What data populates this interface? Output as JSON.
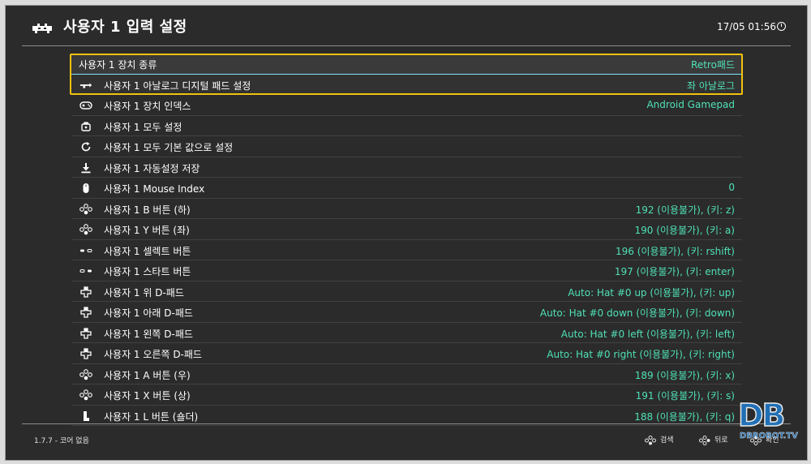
{
  "header": {
    "title": "사용자 1 입력 설정",
    "clock": "17/05 01:56"
  },
  "rows": [
    {
      "icon": "none",
      "label": "사용자 1 장치 종류",
      "value": "Retro패드"
    },
    {
      "icon": "analog-dpad-icon",
      "label": "사용자 1 아날로그 디지털 패드 설정",
      "value": "좌 아날로그"
    },
    {
      "icon": "gamepad-icon",
      "label": "사용자 1 장치 인덱스",
      "value": "Android Gamepad"
    },
    {
      "icon": "bind-all-icon",
      "label": "사용자 1 모두 설정",
      "value": ""
    },
    {
      "icon": "reload-icon",
      "label": "사용자 1 모두 기본 값으로 설정",
      "value": ""
    },
    {
      "icon": "download-icon",
      "label": "사용자 1 자동설정 저장",
      "value": ""
    },
    {
      "icon": "mouse-icon",
      "label": "사용자 1 Mouse Index",
      "value": "0"
    },
    {
      "icon": "face-buttons-icon",
      "label": "사용자 1 B 버튼 (하)",
      "value": "192 (이용불가), (키: z)"
    },
    {
      "icon": "face-buttons-icon",
      "label": "사용자 1 Y 버튼 (좌)",
      "value": "190 (이용불가), (키: a)"
    },
    {
      "icon": "select-icon",
      "label": "사용자 1 셀렉트 버튼",
      "value": "196 (이용불가), (키: rshift)"
    },
    {
      "icon": "start-icon",
      "label": "사용자 1 스타트 버튼",
      "value": "197 (이용불가), (키: enter)"
    },
    {
      "icon": "dpad-icon",
      "label": "사용자 1 위 D-패드",
      "value": "Auto: Hat #0 up (이용불가), (키: up)"
    },
    {
      "icon": "dpad-icon",
      "label": "사용자 1 아래 D-패드",
      "value": "Auto: Hat #0 down (이용불가), (키: down)"
    },
    {
      "icon": "dpad-icon",
      "label": "사용자 1 왼쪽 D-패드",
      "value": "Auto: Hat #0 left (이용불가), (키: left)"
    },
    {
      "icon": "dpad-icon",
      "label": "사용자 1 오른쪽 D-패드",
      "value": "Auto: Hat #0 right (이용불가), (키: right)"
    },
    {
      "icon": "face-buttons-icon",
      "label": "사용자 1 A 버튼 (우)",
      "value": "189 (이용불가), (키: x)"
    },
    {
      "icon": "face-buttons-icon",
      "label": "사용자 1 X 버튼 (상)",
      "value": "191 (이용불가), (키: s)"
    },
    {
      "icon": "shoulder-icon",
      "label": "사용자 1 L 버튼 (숄더)",
      "value": "188 (이용불가), (키: q)"
    }
  ],
  "footer": {
    "version": "1.7.7 - 코어 없음",
    "search_label": "검색",
    "back_label": "뒤로",
    "ok_label": "확인"
  },
  "watermark": {
    "big": "DB",
    "small": "DBROBOT.TV"
  },
  "colors": {
    "background": "#2b2b2b",
    "value_text": "#4fe0b6",
    "selection_border": "#f2c10f",
    "selection_line": "#7de3ff"
  }
}
